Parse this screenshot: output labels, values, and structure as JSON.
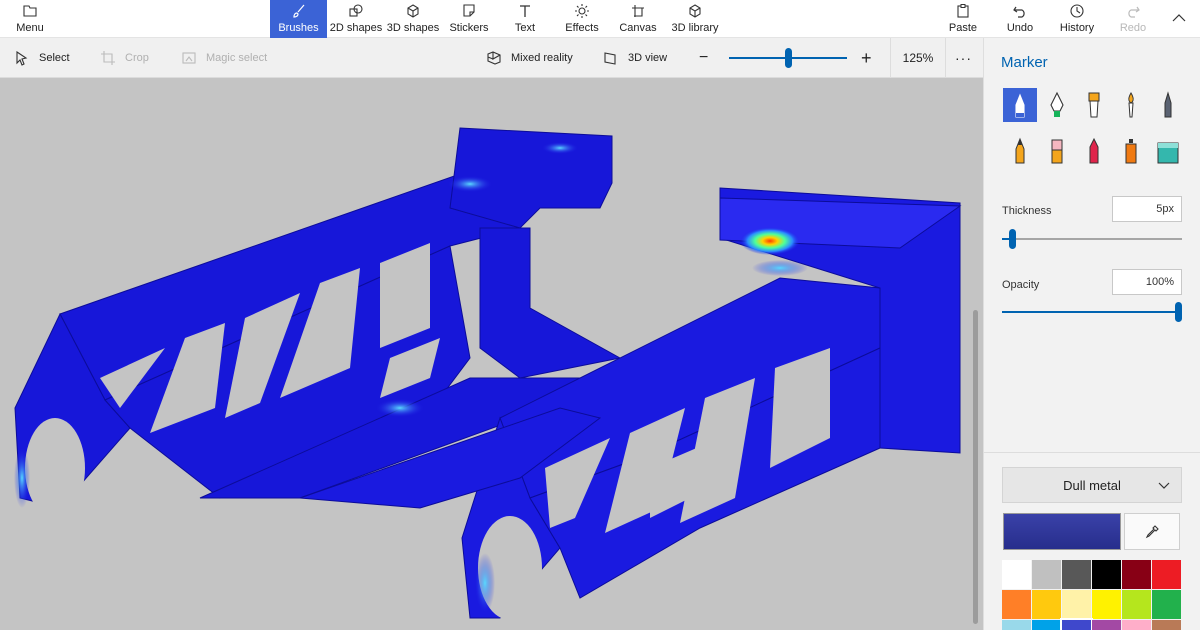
{
  "ribbon": {
    "menu": {
      "label": "Menu",
      "icon": "folder-icon"
    },
    "tools": [
      {
        "label": "Brushes",
        "icon": "brush-icon",
        "active": true
      },
      {
        "label": "2D shapes",
        "icon": "2d-shapes-icon"
      },
      {
        "label": "3D shapes",
        "icon": "3d-shapes-icon"
      },
      {
        "label": "Stickers",
        "icon": "stickers-icon"
      },
      {
        "label": "Text",
        "icon": "text-icon"
      },
      {
        "label": "Effects",
        "icon": "effects-icon"
      },
      {
        "label": "Canvas",
        "icon": "canvas-icon"
      },
      {
        "label": "3D library",
        "icon": "3d-library-icon"
      }
    ],
    "actions": [
      {
        "label": "Paste",
        "icon": "paste-icon"
      },
      {
        "label": "Undo",
        "icon": "undo-icon"
      },
      {
        "label": "History",
        "icon": "history-icon"
      },
      {
        "label": "Redo",
        "icon": "redo-icon",
        "disabled": true
      }
    ],
    "accent": "#3b63d6"
  },
  "toolbar": {
    "select_label": "Select",
    "crop_label": "Crop",
    "magic_select_label": "Magic select",
    "mixed_reality_label": "Mixed reality",
    "view_3d_label": "3D view",
    "zoom_value": "125%",
    "zoom_level": 0.5
  },
  "panel": {
    "title": "Marker",
    "brushes": [
      {
        "name": "marker",
        "active": true
      },
      {
        "name": "calligraphy-pen"
      },
      {
        "name": "oil-brush"
      },
      {
        "name": "watercolor"
      },
      {
        "name": "pixel-pen"
      },
      {
        "name": "pencil"
      },
      {
        "name": "eraser"
      },
      {
        "name": "crayon"
      },
      {
        "name": "spray-can"
      },
      {
        "name": "fill"
      }
    ],
    "thickness_label": "Thickness",
    "thickness_value": "5px",
    "thickness_level": 0.05,
    "opacity_label": "Opacity",
    "opacity_value": "100%",
    "opacity_level": 1.0,
    "material": "Dull metal",
    "current_color": "#272e8c",
    "palette": [
      "#ffffff",
      "#c0c0c0",
      "#585858",
      "#000000",
      "#880015",
      "#ed1c24",
      "#ff7f27",
      "#ffc90e",
      "#fff2a8",
      "#fff200",
      "#b5e61d",
      "#22b14c",
      "#99d9ea",
      "#00a2e8",
      "#3f48cc",
      "#a349a4",
      "#ffaec9",
      "#b97a57"
    ]
  }
}
